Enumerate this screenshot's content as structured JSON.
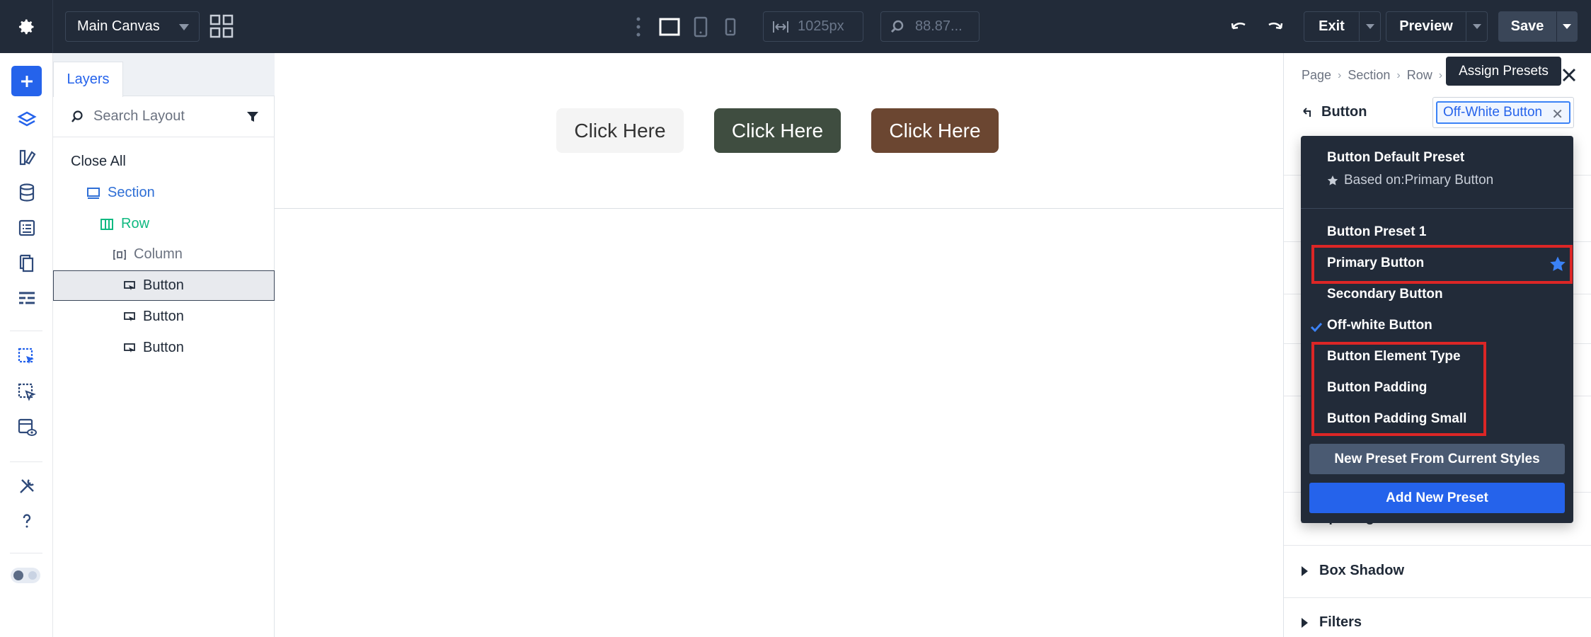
{
  "topbar": {
    "canvas_select": "Main Canvas",
    "width_value": "1025px",
    "zoom_value": "88.87...",
    "exit_label": "Exit",
    "preview_label": "Preview",
    "save_label": "Save"
  },
  "layers": {
    "tab_label": "Layers",
    "search_placeholder": "Search Layout",
    "close_all": "Close All",
    "tree": [
      {
        "label": "Section",
        "color": "#2f6fd6"
      },
      {
        "label": "Row",
        "color": "#10b981"
      },
      {
        "label": "Column",
        "color": "#6b7280"
      },
      {
        "label": "Button",
        "color": "#1f2937"
      },
      {
        "label": "Button",
        "color": "#1f2937"
      },
      {
        "label": "Button",
        "color": "#1f2937"
      }
    ]
  },
  "canvas": {
    "buttons": [
      "Click Here",
      "Click Here",
      "Click Here"
    ]
  },
  "settings": {
    "breadcrumb": [
      "Page",
      "Section",
      "Row"
    ],
    "module_label": "Button",
    "preset_tag": "Off-White Button",
    "tooltip": "Assign Presets",
    "groups": [
      "Spacing",
      "Box Shadow",
      "Filters"
    ]
  },
  "dropdown": {
    "default_title": "Button Default Preset",
    "default_sub": "Based on:Primary Button",
    "items": [
      "Button Preset 1",
      "Primary Button",
      "Secondary Button",
      "Off-white Button",
      "Button Element Type",
      "Button Padding",
      "Button Padding Small"
    ],
    "new_preset_label": "New Preset From Current Styles",
    "add_preset_label": "Add New Preset"
  },
  "colors": {
    "topbar_bg": "#222b39",
    "accent_blue": "#2563eb",
    "highlight_red": "#dc2626",
    "section_blue": "#2f6fd6",
    "row_green": "#10b981",
    "button_offwhite": "#f4f4f4",
    "button_green": "#3f4d40",
    "button_brown": "#6b4631"
  }
}
